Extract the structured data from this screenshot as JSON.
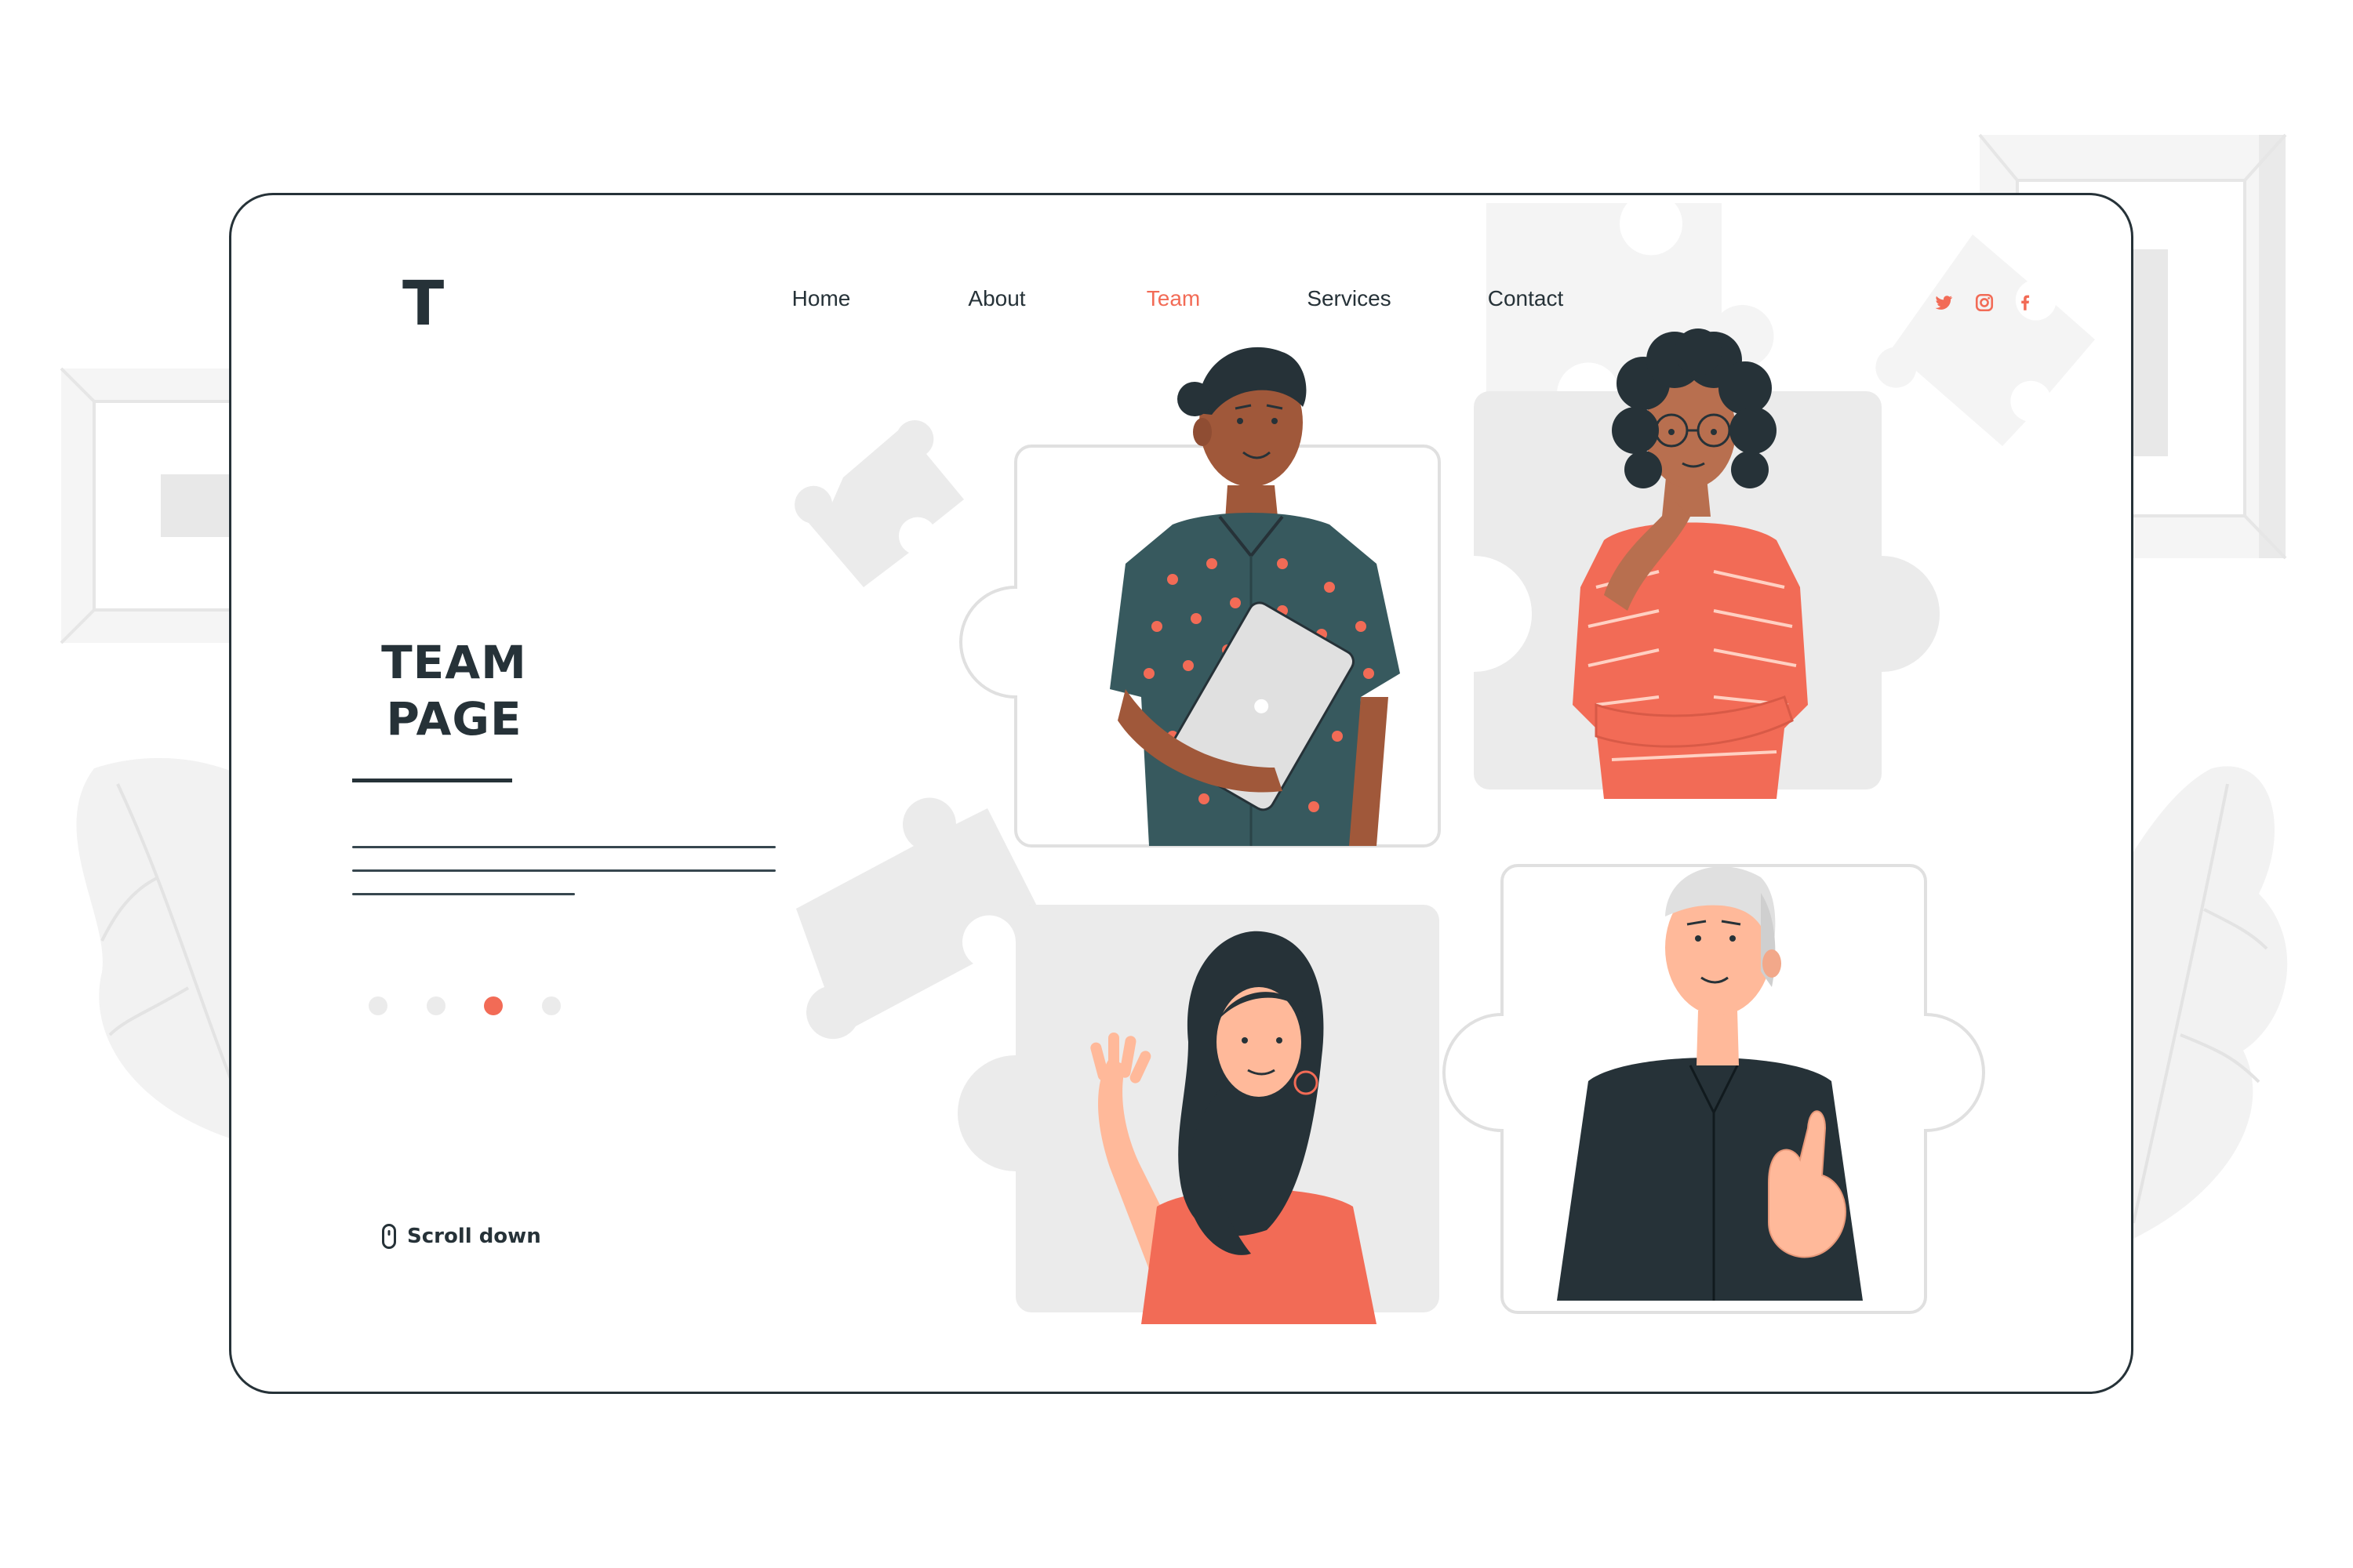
{
  "site": {
    "logo": "T"
  },
  "nav": {
    "items": [
      {
        "label": "Home",
        "active": false
      },
      {
        "label": "About",
        "active": false
      },
      {
        "label": "Team",
        "active": true
      },
      {
        "label": "Services",
        "active": false
      },
      {
        "label": "Contact",
        "active": false
      }
    ]
  },
  "social": [
    {
      "icon": "twitter-icon"
    },
    {
      "icon": "instagram-icon"
    },
    {
      "icon": "facebook-icon"
    }
  ],
  "hero": {
    "title_line1": "TEAM",
    "title_line2": "PAGE"
  },
  "carousel": {
    "count": 4,
    "active_index": 2
  },
  "scroll": {
    "label": "Scroll down"
  },
  "team": [
    {
      "name": "",
      "shirt": "patterned-teal-with-laptop"
    },
    {
      "name": "",
      "shirt": "coral-striped-with-glasses"
    },
    {
      "name": "",
      "shirt": "coral-waving"
    },
    {
      "name": "",
      "shirt": "black-thumbs-up"
    }
  ],
  "colors": {
    "accent": "#f26b56",
    "dark": "#263238",
    "light_gray": "#ebebeb",
    "teal_shirt": "#37595e",
    "skin_dark": "#a0583a",
    "skin_medium": "#b86f4f",
    "skin_light": "#ffb99a"
  }
}
